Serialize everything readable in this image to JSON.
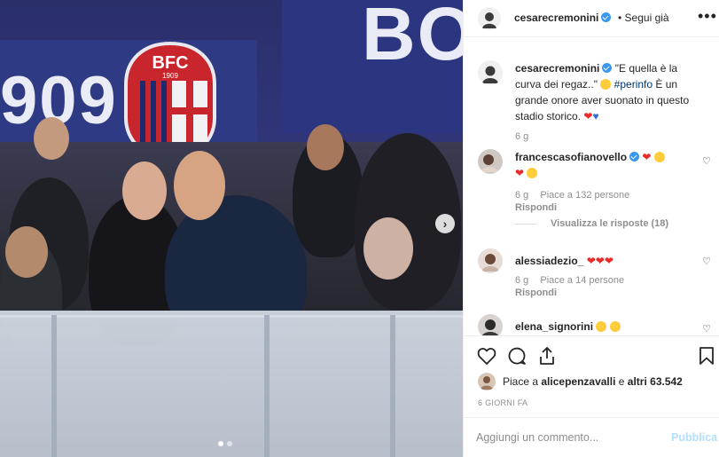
{
  "post": {
    "username": "cesarecremonini",
    "follow_label": "Segui già",
    "separator": "•",
    "more_label": "•••",
    "photo_banner_text_left": "909",
    "photo_banner_text_right": "BO",
    "crest_text": "BFC",
    "crest_year": "1909",
    "carousel": {
      "total": 2,
      "active": 0
    }
  },
  "caption": {
    "username": "cesarecremonini",
    "text_1": "\"E quella è la curva dei regaz..\"",
    "hashtag": "#perinfo",
    "text_2": "È un grande onore aver suonato in questo stadio storico.",
    "emoji_hearts": "❤",
    "emoji_blue_heart": "♥",
    "age": "6 g"
  },
  "comments": [
    {
      "username": "francescasofianovello",
      "verified": true,
      "emojis": "❤",
      "age": "6 g",
      "likes": "Piace a 132 persone",
      "reply": "Rispondi",
      "view_replies": "Visualizza le risposte (18)"
    },
    {
      "username": "alessiadezio_",
      "verified": false,
      "emojis": "❤❤❤",
      "age": "6 g",
      "likes": "Piace a 14 persone",
      "reply": "Rispondi"
    },
    {
      "username": "elena_signorini",
      "verified": false,
      "emojis": ""
    }
  ],
  "actions": {
    "like_icon": "heart-outline-icon",
    "comment_icon": "comment-icon",
    "share_icon": "share-icon",
    "save_icon": "bookmark-icon"
  },
  "likes_summary": {
    "prefix": "Piace a",
    "user": "alicepenzavalli",
    "connector": "e",
    "others": "altri 63.542"
  },
  "timestamp": "6 GIORNI FA",
  "add_comment": {
    "placeholder": "Aggiungi un commento...",
    "publish_label": "Pubblica"
  },
  "colors": {
    "link": "#003569",
    "verified": "#3897f0",
    "publish": "#b2dffc",
    "muted": "#8e8e8e"
  }
}
